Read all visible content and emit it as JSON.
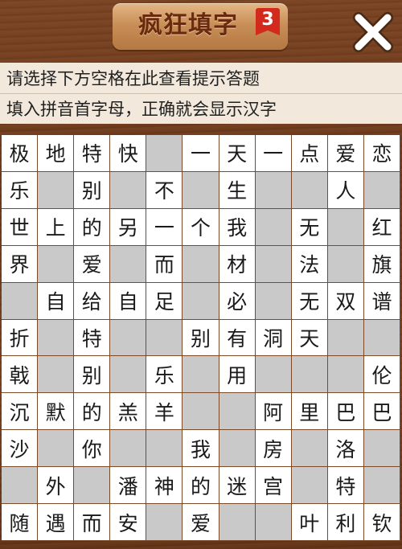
{
  "header": {
    "title": "疯狂填字",
    "level_badge": "3",
    "close_icon": "close-icon"
  },
  "hint": {
    "line1": "请选择下方空格在此查看提示答题",
    "line2": "填入拼音首字母，正确就会显示汉字"
  },
  "grid": {
    "rows": [
      [
        "极",
        "地",
        "特",
        "快",
        "#",
        "一",
        "天",
        "一",
        "点",
        "爱",
        "恋"
      ],
      [
        "乐",
        "",
        "别",
        "",
        "不",
        "",
        "生",
        "",
        "",
        "人",
        ""
      ],
      [
        "世",
        "上",
        "的",
        "另",
        "一",
        "个",
        "我",
        "",
        "无",
        "",
        "红"
      ],
      [
        "界",
        "",
        "爱",
        "",
        "而",
        "",
        "材",
        "",
        "法",
        "",
        "旗"
      ],
      [
        "",
        "自",
        "给",
        "自",
        "足",
        "",
        "必",
        "",
        "无",
        "双",
        "谱"
      ],
      [
        "折",
        "",
        "特",
        "",
        "",
        "别",
        "有",
        "洞",
        "天",
        "",
        ""
      ],
      [
        "戟",
        "",
        "别",
        "",
        "乐",
        "",
        "用",
        "",
        "",
        "",
        "伦"
      ],
      [
        "沉",
        "默",
        "的",
        "羔",
        "羊",
        "",
        "",
        "阿",
        "里",
        "巴",
        "巴"
      ],
      [
        "沙",
        "",
        "你",
        "",
        "",
        "我",
        "",
        "房",
        "",
        "洛",
        ""
      ],
      [
        "",
        "外",
        "",
        "潘",
        "神",
        "的",
        "迷",
        "宫",
        "",
        "特",
        ""
      ],
      [
        "随",
        "遇",
        "而",
        "安",
        "",
        "爱",
        "",
        "",
        "叶",
        "利",
        "钦"
      ]
    ]
  }
}
